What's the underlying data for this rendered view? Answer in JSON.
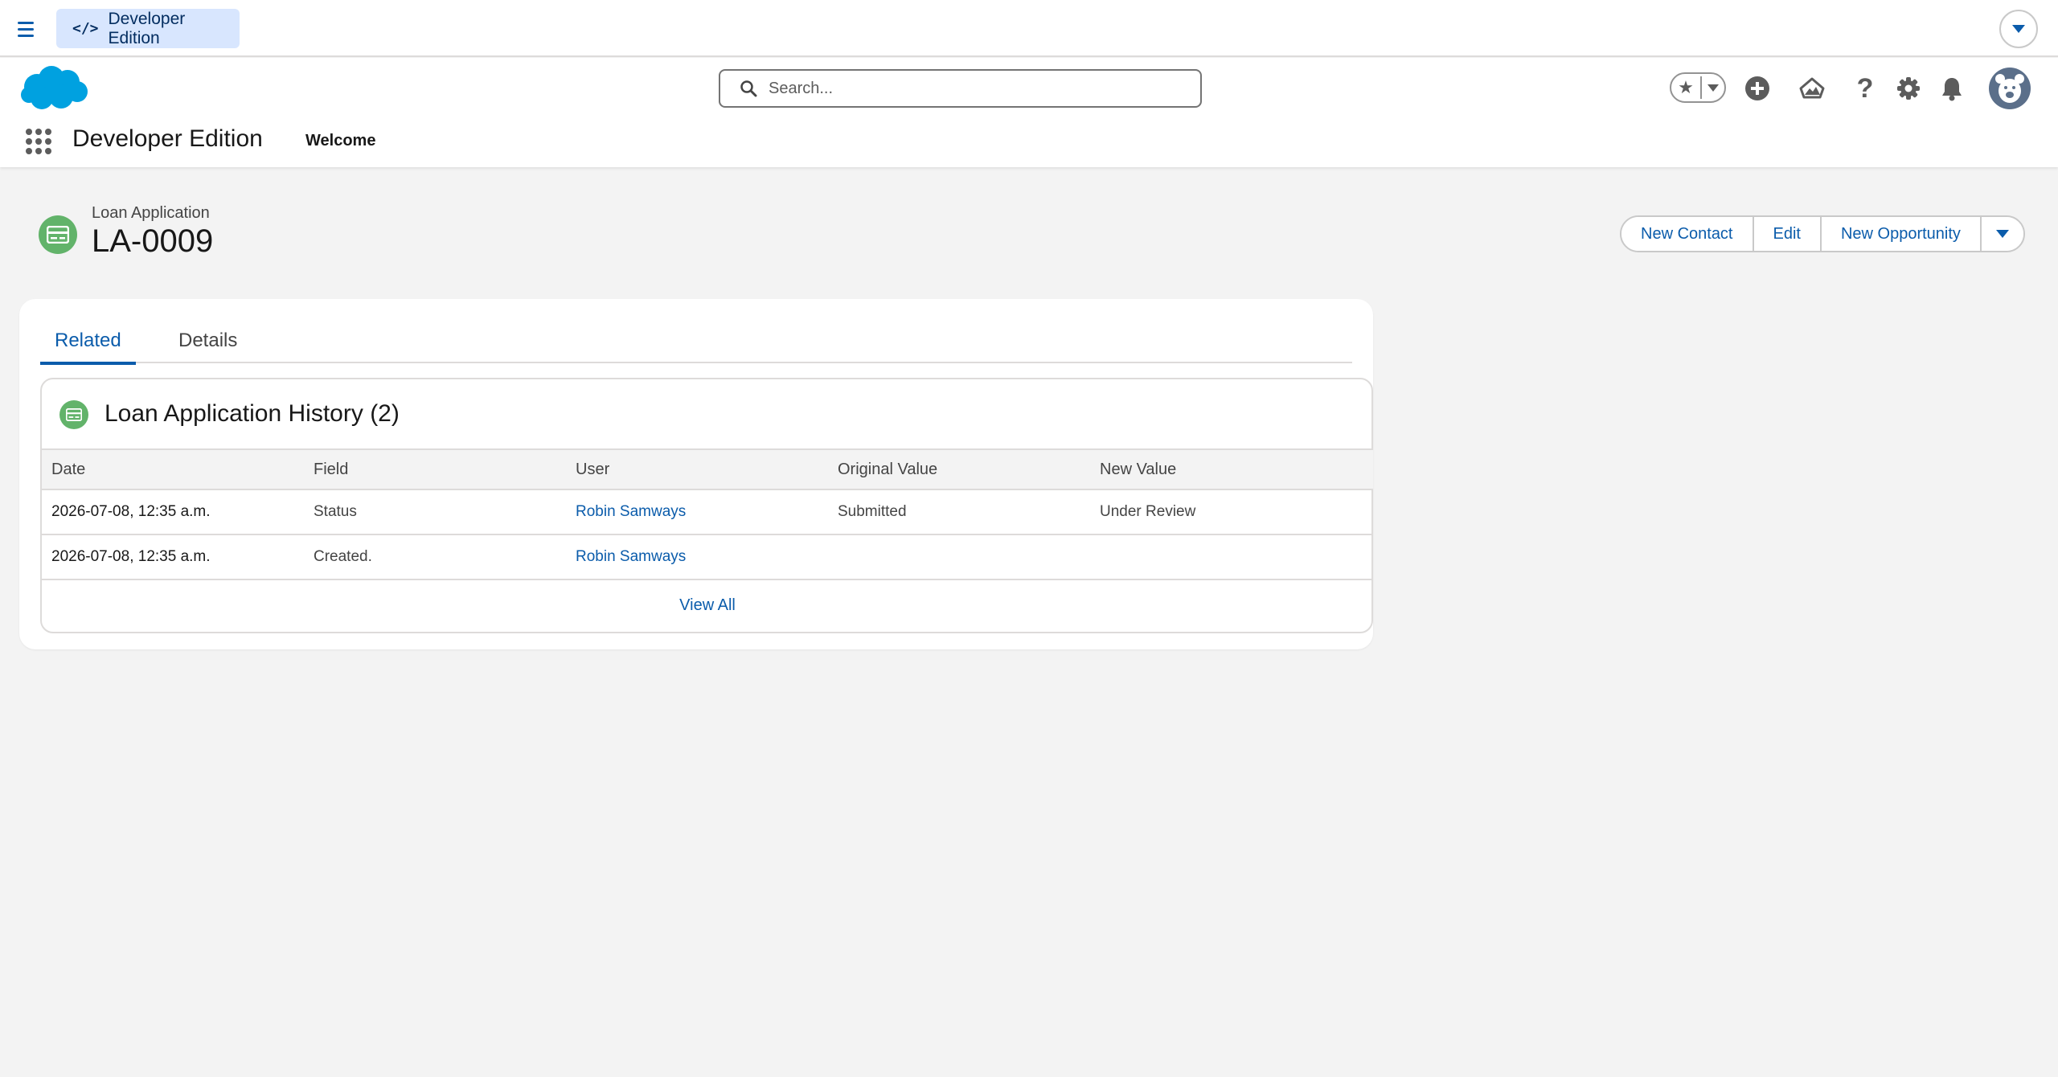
{
  "utility_bar": {
    "org_label": "Developer Edition"
  },
  "header": {
    "search_placeholder": "Search...",
    "app_name": "Developer Edition",
    "nav_tab": "Welcome"
  },
  "record": {
    "object_type": "Loan Application",
    "title": "LA-0009",
    "actions": {
      "new_contact": "New Contact",
      "edit": "Edit",
      "new_opportunity": "New Opportunity"
    }
  },
  "tabs": {
    "related": "Related",
    "details": "Details"
  },
  "related_list": {
    "title": "Loan Application History (2)",
    "columns": [
      "Date",
      "Field",
      "User",
      "Original Value",
      "New Value"
    ],
    "rows": [
      [
        "2026-07-08, 12:35 a.m.",
        "Status",
        "Robin Samways",
        "Submitted",
        "Under Review"
      ],
      [
        "2026-07-08, 12:35 a.m.",
        "Created.",
        "Robin Samways",
        "",
        ""
      ]
    ],
    "view_all": "View All"
  },
  "colors": {
    "brand_blue": "#0b5cab",
    "record_icon_green": "#62b36a",
    "logo_blue": "#00a1e0"
  }
}
